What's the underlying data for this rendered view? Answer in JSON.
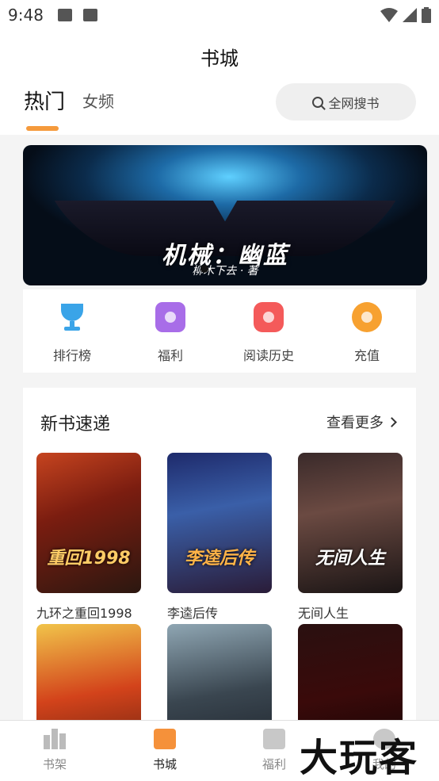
{
  "status_bar": {
    "time": "9:48"
  },
  "header": {
    "title": "书城",
    "tabs": [
      {
        "label": "热门"
      },
      {
        "label": "女频"
      }
    ],
    "search_label": "全网搜书",
    "accent_color": "#f59a3c"
  },
  "banner": {
    "title": "机械：幽蓝",
    "author": "柳木下去 · 著"
  },
  "quick_links": [
    {
      "label": "排行榜",
      "icon": "trophy-icon"
    },
    {
      "label": "福利",
      "icon": "gift-icon"
    },
    {
      "label": "阅读历史",
      "icon": "history-icon"
    },
    {
      "label": "充值",
      "icon": "recharge-icon"
    }
  ],
  "new_books": {
    "title": "新书速递",
    "more_label": "查看更多",
    "books": [
      {
        "name": "九环之重回1998",
        "cover_text": "重回1998"
      },
      {
        "name": "李逵后传",
        "cover_text": "李逵后传"
      },
      {
        "name": "无间人生",
        "cover_text": "无间人生"
      },
      {
        "name": "",
        "cover_text": ""
      },
      {
        "name": "",
        "cover_text": ""
      },
      {
        "name": "",
        "cover_text": ""
      }
    ]
  },
  "bottom_nav": [
    {
      "label": "书架"
    },
    {
      "label": "书城"
    },
    {
      "label": "福利"
    },
    {
      "label": "我的"
    }
  ],
  "watermark": "大玩客"
}
